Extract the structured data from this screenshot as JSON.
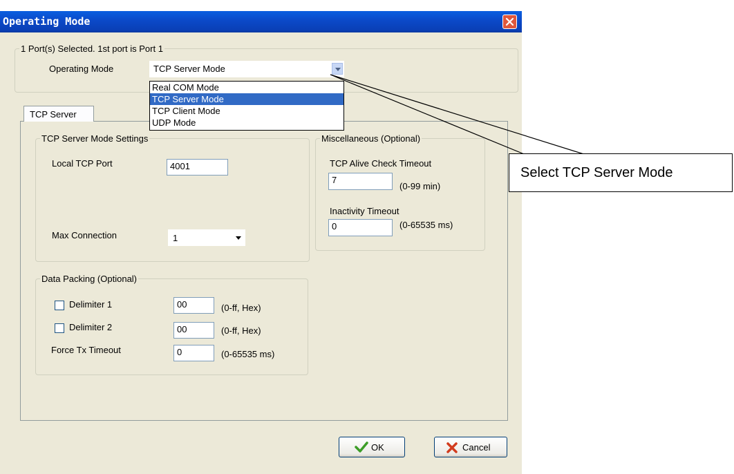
{
  "window": {
    "title": "Operating Mode",
    "close_icon": "close-icon"
  },
  "port_group": {
    "legend": "1 Port(s) Selected. 1st port is Port 1",
    "mode_label": "Operating Mode",
    "mode_value": "TCP Server Mode",
    "dropdown_options": [
      "Real COM Mode",
      "TCP Server Mode",
      "TCP Client Mode",
      "UDP Mode"
    ],
    "selected_option": "TCP Server Mode"
  },
  "tab": {
    "label": "TCP Server"
  },
  "server_settings": {
    "legend": "TCP Server Mode Settings",
    "local_port_label": "Local TCP Port",
    "local_port_value": "4001",
    "max_conn_label": "Max Connection",
    "max_conn_value": "1"
  },
  "misc": {
    "legend": "Miscellaneous (Optional)",
    "alive_label": "TCP Alive Check Timeout",
    "alive_value": "7",
    "alive_unit": "(0-99 min)",
    "inactivity_label": "Inactivity Timeout",
    "inactivity_value": "0",
    "inactivity_unit": "(0-65535 ms)"
  },
  "packing": {
    "legend": "Data Packing (Optional)",
    "delim1_label": "Delimiter 1",
    "delim1_value": "00",
    "delim1_unit": "(0-ff, Hex)",
    "delim1_checked": false,
    "delim2_label": "Delimiter 2",
    "delim2_value": "00",
    "delim2_unit": "(0-ff, Hex)",
    "delim2_checked": false,
    "force_label": "Force Tx Timeout",
    "force_value": "0",
    "force_unit": "(0-65535 ms)"
  },
  "buttons": {
    "ok": "OK",
    "cancel": "Cancel"
  },
  "annotation": {
    "text": "Select TCP Server Mode"
  },
  "colors": {
    "title_bar": "#0a4fd0",
    "dialog_bg": "#ece9d8",
    "selection": "#316ac5",
    "close": "#e0583c"
  }
}
